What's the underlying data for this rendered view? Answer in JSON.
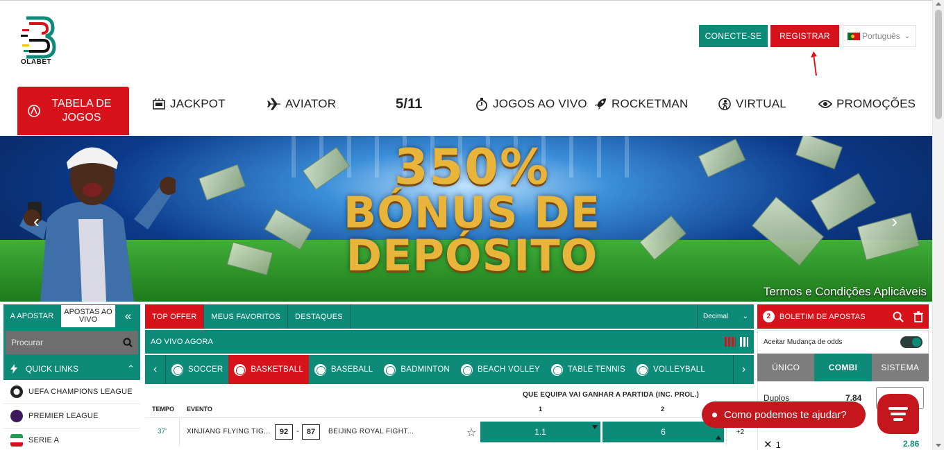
{
  "brand": {
    "name": "OLABET",
    "primary": "#0e8a78",
    "accent": "#d6121b"
  },
  "header": {
    "connect_label": "CONECTE-SE",
    "register_label": "REGISTRAR",
    "language": "Português"
  },
  "nav": {
    "items": [
      {
        "label": "TABELA DE JOGOS",
        "icon": "sports-table-icon"
      },
      {
        "label": "JACKPOT",
        "icon": "jackpot-icon"
      },
      {
        "label": "AVIATOR",
        "icon": "airplane-icon"
      },
      {
        "label": "5/11",
        "icon": ""
      },
      {
        "label": "JOGOS AO VIVO",
        "icon": "stopwatch-icon"
      },
      {
        "label": "ROCKETMAN",
        "icon": "rocket-icon"
      },
      {
        "label": "VIRTUAL",
        "icon": "virtual-icon"
      },
      {
        "label": "PROMOÇÕES",
        "icon": "eye-icon"
      }
    ]
  },
  "banner": {
    "line1": "350%",
    "line2": "BÓNUS DE",
    "line3": "DEPÓSITO",
    "terms": "Termos e Condições Aplicáveis"
  },
  "sidebar": {
    "tab_apostar": "A APOSTAR",
    "tab_ao_vivo": "APOSTAS AO VIVO",
    "collapse_icon": "double-chevron-left-icon",
    "search_placeholder": "Procurar",
    "quick_links_label": "QUICK LINKS",
    "items": [
      {
        "label": "UEFA CHAMPIONS LEAGUE",
        "icon": "champions-league-icon"
      },
      {
        "label": "PREMIER LEAGUE",
        "icon": "premier-league-icon"
      },
      {
        "label": "SERIE A",
        "icon": "serie-a-icon"
      }
    ]
  },
  "center": {
    "tabs": [
      "TOP OFFER",
      "MEUS FAVORITOS",
      "DESTAQUES"
    ],
    "odds_format": "Decimal",
    "live_label": "AO VIVO AGORA",
    "sports": [
      "SOCCER",
      "BASKETBALL",
      "BASEBALL",
      "BADMINTON",
      "BEACH VOLLEY",
      "TABLE TENNIS",
      "VOLLEYBALL"
    ],
    "active_sport": "BASKETBALL",
    "market_title": "QUE EQUIPA VAI GANHAR A PARTIDA (INC. PROL.)",
    "col_tempo": "TEMPO",
    "col_evento": "EVENTO",
    "col_1": "1",
    "col_2": "2",
    "event": {
      "time": "37'",
      "home": "XINJIANG FLYING TIG...",
      "home_score": "92",
      "away_score": "87",
      "away": "BEIJING ROYAL FIGHT...",
      "odd_1": "1.1",
      "odd_2": "6",
      "more": "+2"
    }
  },
  "betslip": {
    "count": "2",
    "title": "BOLETIM DE APOSTAS",
    "accept_label": "Aceitar Mudança de odds",
    "types": [
      "ÚNICO",
      "COMBI",
      "SISTEMA"
    ],
    "active_type": "COMBI",
    "duplos_label": "Duplos",
    "duplos_value": "7.84",
    "selection_label": "1",
    "selection_value": "2.86"
  },
  "chat": {
    "prompt": "Como podemos te ajudar?"
  }
}
